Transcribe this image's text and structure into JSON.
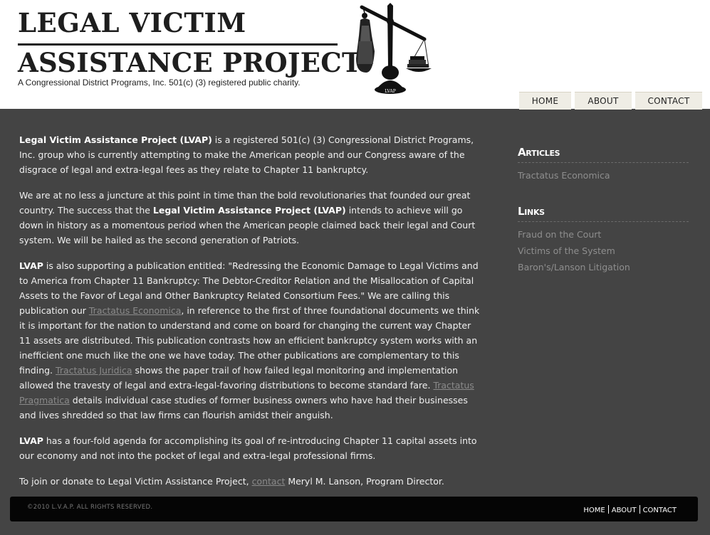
{
  "header": {
    "title_line1": "LEGAL VICTIM",
    "title_line2": "ASSISTANCE PROJECT",
    "tagline": "A Congressional District Programs, Inc. 501(c) (3) registered public charity.",
    "logo_text": "LVAP"
  },
  "nav": {
    "items": [
      "HOME",
      "ABOUT",
      "CONTACT"
    ]
  },
  "content": {
    "p1": {
      "b1": "Legal Victim Assistance Project (LVAP)",
      "t1": " is a registered 501(c) (3) Congressional District Programs, Inc. group who is currently attempting to make the American people and our Congress aware of the disgrace of legal and extra-legal fees as they relate to Chapter 11 bankruptcy."
    },
    "p2": {
      "t1": "We are at no less a juncture at this point in time than the bold revolutionaries that founded our great country. The success that the ",
      "b1": "Legal Victim Assistance Project (LVAP)",
      "t2": " intends to achieve will go down in history as a momentous period when the American people claimed back their legal and Court system. We will be hailed as the second generation of Patriots."
    },
    "p3": {
      "b1": "LVAP",
      "t1": " is also supporting a publication entitled: \"Redressing the Economic Damage to Legal Victims and to America from Chapter 11 Bankruptcy: The Debtor-Creditor Relation and the Misallocation of Capital Assets to the Favor of Legal and Other Bankruptcy Related Consortium Fees.\"  We are calling this publication our ",
      "link1": "Tractatus Economica",
      "t2": ", in reference to the first of three foundational documents we think it is important for the nation to understand and come on board for changing the current way Chapter 11 assets are distributed. This publication contrasts how an efficient bankruptcy system works with an inefficient one much like the one we have today. The other publications are complementary to this finding. ",
      "link2": "Tractatus Juridica",
      "t3": " shows the paper trail of how failed legal monitoring and implementation allowed the travesty of legal and extra-legal-favoring distributions to become standard fare. ",
      "link3": "Tractatus Pragmatica",
      "t4": " details individual case studies of former business owners who have had their businesses and lives shredded so that law firms can flourish amidst their anguish."
    },
    "p4": {
      "b1": "LVAP",
      "t1": " has a four-fold agenda for accomplishing its goal of re-introducing Chapter 11 capital assets into our economy and not into the pocket of legal and extra-legal professional firms."
    },
    "p5": {
      "t1": "To join or donate to Legal Victim Assistance Project, ",
      "link1": "contact",
      "t2": " Meryl M. Lanson, Program Director."
    }
  },
  "sidebar": {
    "articles_heading": "Articles",
    "articles": [
      "Tractatus Economica"
    ],
    "links_heading": "Links",
    "links": [
      "Fraud on the Court",
      "Victims of the System",
      "Baron's/Lanson Litigation"
    ]
  },
  "footer": {
    "copyright": "©2010 L.V.A.P.  ALL RIGHTS RESERVED.",
    "nav": [
      "HOME",
      "ABOUT",
      "CONTACT"
    ]
  },
  "colors": {
    "body_bg": "#444444",
    "nav_bg": "#efede5",
    "footer_bg": "#050505",
    "link": "#8a8a8a"
  }
}
